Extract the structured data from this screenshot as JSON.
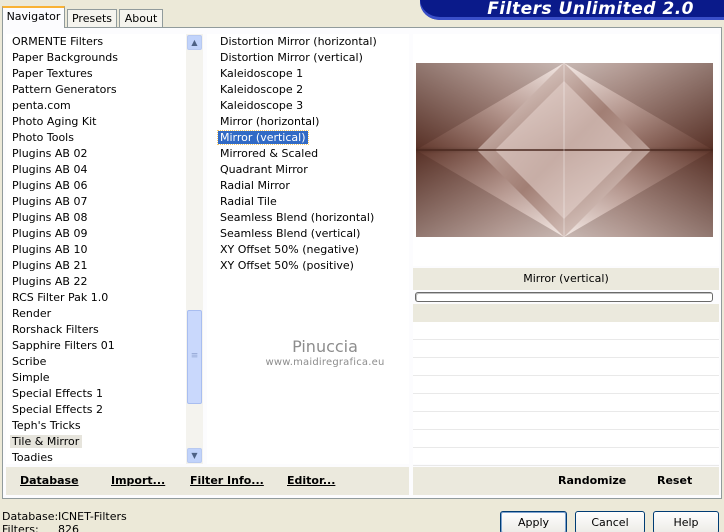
{
  "tabs": [
    {
      "label": "Navigator"
    },
    {
      "label": "Presets"
    },
    {
      "label": "About"
    }
  ],
  "banner": {
    "title": "Filters Unlimited 2.0"
  },
  "categories": {
    "items": [
      "ORMENTE Filters",
      "Paper Backgrounds",
      "Paper Textures",
      "Pattern Generators",
      "penta.com",
      "Photo Aging Kit",
      "Photo Tools",
      "Plugins AB 02",
      "Plugins AB 04",
      "Plugins AB 06",
      "Plugins AB 07",
      "Plugins AB 08",
      "Plugins AB 09",
      "Plugins AB 10",
      "Plugins AB 21",
      "Plugins AB 22",
      "RCS Filter Pak 1.0",
      "Render",
      "Rorshack Filters",
      "Sapphire Filters 01",
      "Scribe",
      "Simple",
      "Special Effects 1",
      "Special Effects 2",
      "Teph's Tricks",
      "Tile & Mirror",
      "Toadies"
    ],
    "selected": "Tile & Mirror"
  },
  "filters": {
    "items": [
      "Distortion Mirror (horizontal)",
      "Distortion Mirror (vertical)",
      "Kaleidoscope 1",
      "Kaleidoscope 2",
      "Kaleidoscope 3",
      "Mirror (horizontal)",
      "Mirror (vertical)",
      "Mirrored & Scaled",
      "Quadrant Mirror",
      "Radial Mirror",
      "Radial Tile",
      "Seamless Blend (horizontal)",
      "Seamless Blend (vertical)",
      "XY Offset 50% (negative)",
      "XY Offset 50% (positive)"
    ],
    "selected": "Mirror (vertical)"
  },
  "watermark": {
    "name": "Pinuccia",
    "url": "www.maidiregrafica.eu"
  },
  "preview": {
    "filter_name": "Mirror (vertical)",
    "progress": 0
  },
  "buttons": {
    "database": "Database",
    "import": "Import...",
    "filter_info": "Filter Info...",
    "editor": "Editor...",
    "randomize": "Randomize",
    "reset": "Reset",
    "apply": "Apply",
    "cancel": "Cancel",
    "help": "Help"
  },
  "status": {
    "database_label": "Database:",
    "database_value": "ICNET-Filters",
    "filters_label": "Filters:",
    "filters_value": "826"
  },
  "colors": {
    "banner": "#0a1a8a",
    "selection": "#316ac5",
    "preview_dark": "#4e2c22",
    "preview_light": "#f4e8e4"
  }
}
